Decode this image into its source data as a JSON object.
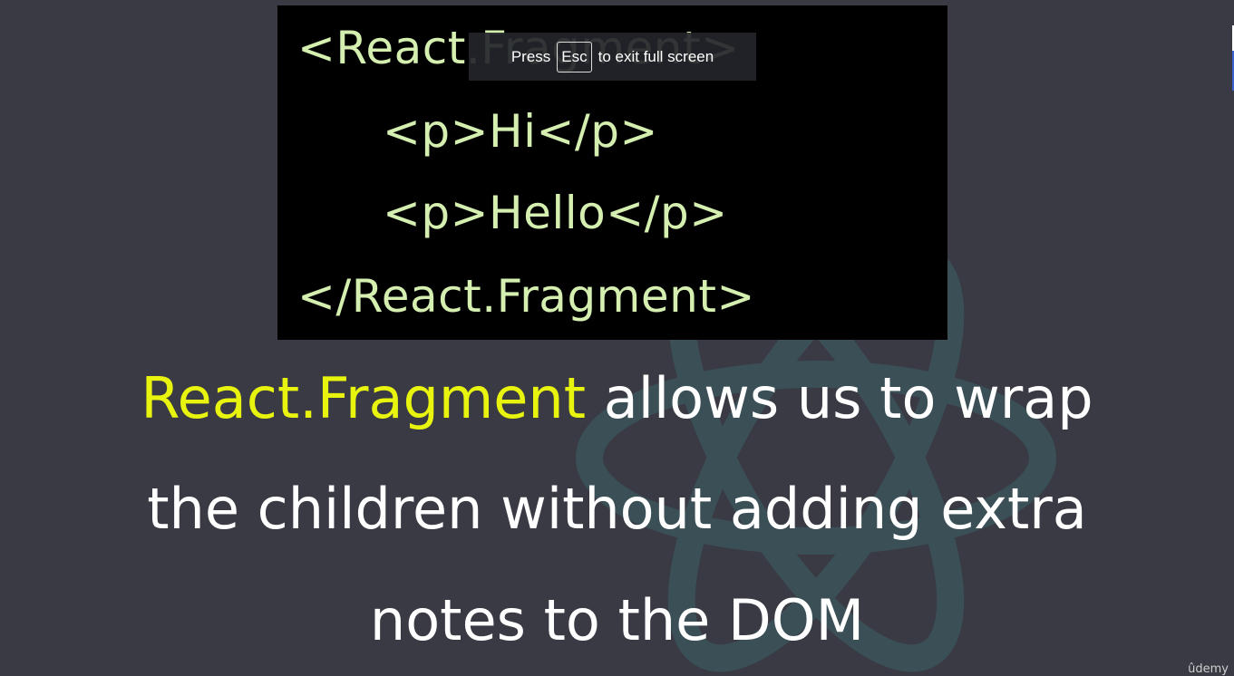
{
  "code_lines": [
    "<React.Fragment>",
    "<p>Hi</p>",
    "<p>Hello</p>",
    "</React.Fragment>"
  ],
  "fullscreen_toast": {
    "before": "Press",
    "key": "Esc",
    "after": "to exit full screen"
  },
  "caption": {
    "highlight": "React.Fragment",
    "line1_rest": " allows us to wrap",
    "line2": "the children without adding extra",
    "line3": "notes to the DOM"
  },
  "brand": "ûdemy",
  "colors": {
    "background": "#393a43",
    "code_text": "#d4efb0",
    "highlight": "#e9f40e"
  }
}
